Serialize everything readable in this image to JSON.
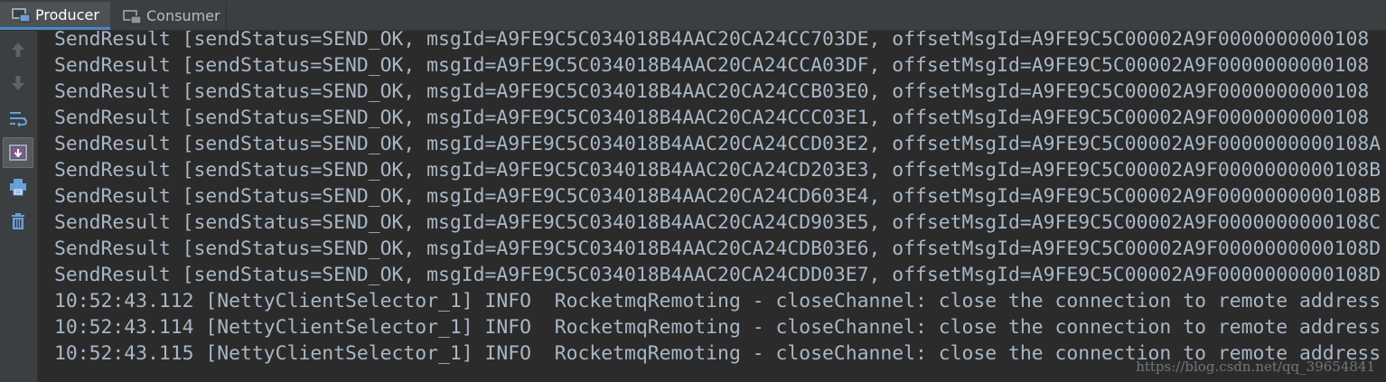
{
  "tabs": [
    {
      "label": "Producer",
      "active": true
    },
    {
      "label": "Consumer",
      "active": false
    }
  ],
  "toolbar": {
    "icons": [
      "arrow-up-icon",
      "arrow-down-icon",
      "soft-wrap-icon",
      "scroll-to-end-icon",
      "print-icon",
      "trash-icon"
    ]
  },
  "console": {
    "lines": [
      "SendResult [sendStatus=SEND_OK, msgId=A9FE9C5C034018B4AAC20CA24CC703DE, offsetMsgId=A9FE9C5C00002A9F0000000000108",
      "SendResult [sendStatus=SEND_OK, msgId=A9FE9C5C034018B4AAC20CA24CCA03DF, offsetMsgId=A9FE9C5C00002A9F0000000000108",
      "SendResult [sendStatus=SEND_OK, msgId=A9FE9C5C034018B4AAC20CA24CCB03E0, offsetMsgId=A9FE9C5C00002A9F0000000000108",
      "SendResult [sendStatus=SEND_OK, msgId=A9FE9C5C034018B4AAC20CA24CCC03E1, offsetMsgId=A9FE9C5C00002A9F0000000000108",
      "SendResult [sendStatus=SEND_OK, msgId=A9FE9C5C034018B4AAC20CA24CCD03E2, offsetMsgId=A9FE9C5C00002A9F0000000000108A",
      "SendResult [sendStatus=SEND_OK, msgId=A9FE9C5C034018B4AAC20CA24CD203E3, offsetMsgId=A9FE9C5C00002A9F0000000000108B",
      "SendResult [sendStatus=SEND_OK, msgId=A9FE9C5C034018B4AAC20CA24CD603E4, offsetMsgId=A9FE9C5C00002A9F0000000000108B",
      "SendResult [sendStatus=SEND_OK, msgId=A9FE9C5C034018B4AAC20CA24CD903E5, offsetMsgId=A9FE9C5C00002A9F0000000000108C",
      "SendResult [sendStatus=SEND_OK, msgId=A9FE9C5C034018B4AAC20CA24CDB03E6, offsetMsgId=A9FE9C5C00002A9F0000000000108D",
      "SendResult [sendStatus=SEND_OK, msgId=A9FE9C5C034018B4AAC20CA24CDD03E7, offsetMsgId=A9FE9C5C00002A9F0000000000108D",
      "10:52:43.112 [NettyClientSelector_1] INFO  RocketmqRemoting - closeChannel: close the connection to remote address",
      "10:52:43.114 [NettyClientSelector_1] INFO  RocketmqRemoting - closeChannel: close the connection to remote address",
      "10:52:43.115 [NettyClientSelector_1] INFO  RocketmqRemoting - closeChannel: close the connection to remote address"
    ]
  },
  "watermark": "https://blog.csdn.net/qq_39654841",
  "colors": {
    "background": "#2b2b2b",
    "panel": "#3c3f41",
    "text": "#a9b7c6",
    "accent": "#4a88c7"
  }
}
